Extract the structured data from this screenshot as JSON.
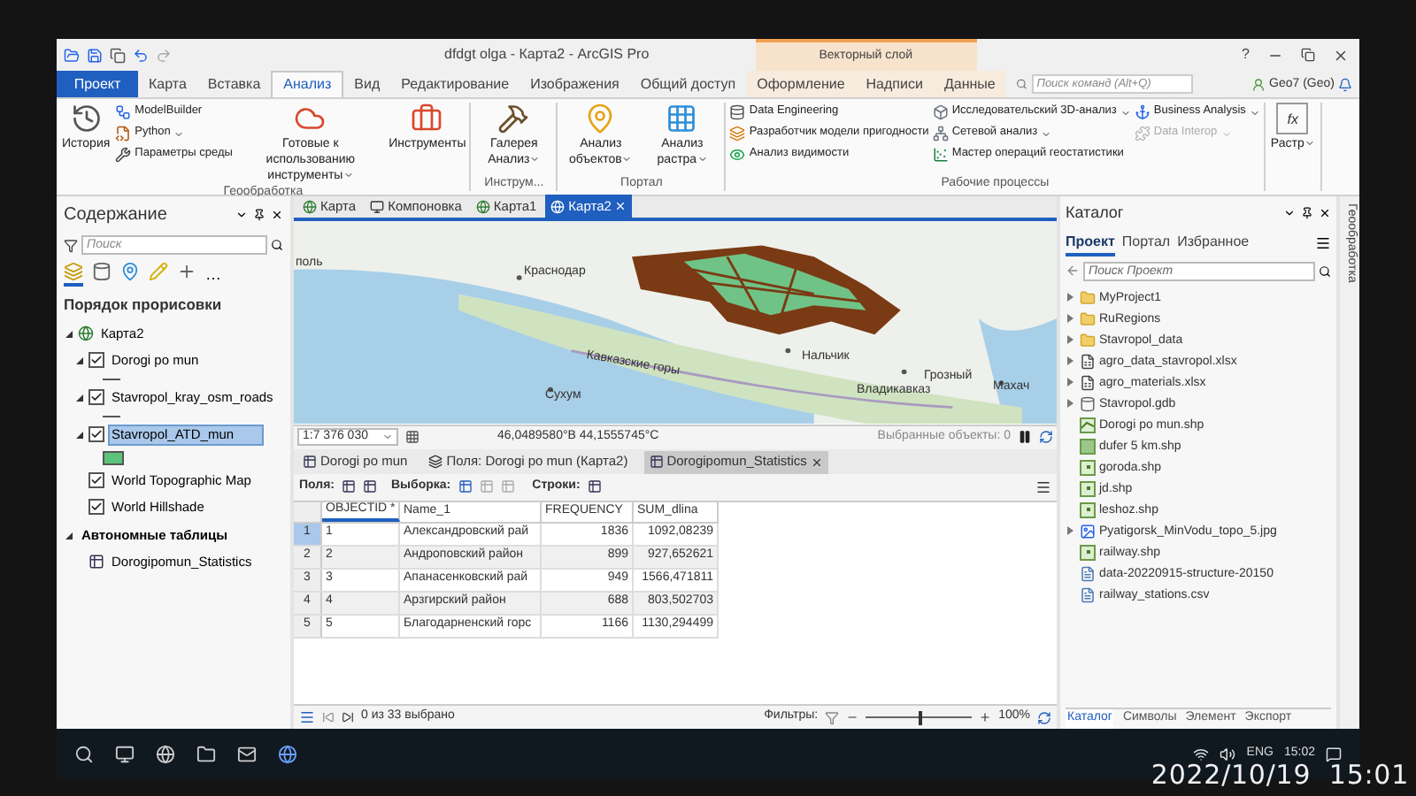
{
  "window": {
    "title": "dfdgt olga - Карта2 - ArcGIS Pro",
    "context_label": "Векторный слой",
    "help": "?"
  },
  "ribbon_tabs": [
    {
      "label": "Проект",
      "kind": "backstage",
      "selected": false
    },
    {
      "label": "Карта",
      "kind": "tab",
      "selected": false
    },
    {
      "label": "Вставка",
      "kind": "tab",
      "selected": false
    },
    {
      "label": "Анализ",
      "kind": "tab",
      "selected": true
    },
    {
      "label": "Вид",
      "kind": "tab",
      "selected": false
    },
    {
      "label": "Редактирование",
      "kind": "tab",
      "selected": false
    },
    {
      "label": "Изображения",
      "kind": "tab",
      "selected": false
    },
    {
      "label": "Общий доступ",
      "kind": "tab",
      "selected": false
    },
    {
      "label": "Оформление",
      "kind": "context",
      "selected": false
    },
    {
      "label": "Надписи",
      "kind": "context",
      "selected": false
    },
    {
      "label": "Данные",
      "kind": "context",
      "selected": false
    }
  ],
  "command_search": {
    "placeholder": "Поиск команд (Alt+Q)"
  },
  "user": {
    "name": "Geo7 (Geo)"
  },
  "ribbon_groups": [
    {
      "title": "Геообработка",
      "items": [
        {
          "label": "История",
          "kind": "large",
          "dropdown": false,
          "disabled": false
        },
        {
          "label": "ModelBuilder",
          "kind": "small",
          "dropdown": false,
          "disabled": false
        },
        {
          "label": "Python",
          "kind": "small",
          "dropdown": true,
          "disabled": false
        },
        {
          "label": "Параметры среды",
          "kind": "small",
          "dropdown": false,
          "disabled": false
        },
        {
          "label": "Готовые к использованию инструменты",
          "kind": "large",
          "dropdown": true,
          "disabled": false
        },
        {
          "label": "Инструменты",
          "kind": "large",
          "dropdown": false,
          "disabled": false
        }
      ]
    },
    {
      "title": "Инструм...",
      "items": [
        {
          "label": "Галерея Анализ",
          "kind": "large",
          "dropdown": true,
          "disabled": false
        }
      ]
    },
    {
      "title": "Портал",
      "items": [
        {
          "label": "Анализ объектов",
          "kind": "large",
          "dropdown": true,
          "disabled": false
        },
        {
          "label": "Анализ растра",
          "kind": "large",
          "dropdown": true,
          "disabled": false
        }
      ]
    },
    {
      "title": "Рабочие процессы",
      "items": [
        {
          "label": "Data Engineering",
          "kind": "small",
          "dropdown": false,
          "disabled": false
        },
        {
          "label": "Разработчик модели пригодности",
          "kind": "small",
          "dropdown": false,
          "disabled": false
        },
        {
          "label": "Анализ видимости",
          "kind": "small",
          "dropdown": false,
          "disabled": false
        },
        {
          "label": "Исследовательский 3D-анализ",
          "kind": "small",
          "dropdown": true,
          "disabled": false
        },
        {
          "label": "Сетевой анализ",
          "kind": "small",
          "dropdown": true,
          "disabled": false
        },
        {
          "label": "Мастер операций геостатистики",
          "kind": "small",
          "dropdown": false,
          "disabled": false
        },
        {
          "label": "Business Analysis",
          "kind": "small",
          "dropdown": true,
          "disabled": false
        },
        {
          "label": "Data Interop",
          "kind": "small",
          "dropdown": true,
          "disabled": true
        }
      ]
    },
    {
      "items": [
        {
          "label": "Растр",
          "kind": "large",
          "dropdown": true,
          "disabled": false,
          "glyph": "fx"
        }
      ]
    }
  ],
  "contents": {
    "title": "Содержание",
    "search": {
      "placeholder": "Поиск"
    },
    "modes": [
      {
        "selected": true
      },
      {
        "selected": false
      },
      {
        "selected": false
      },
      {
        "selected": false
      },
      {
        "selected": false
      }
    ],
    "more": "…",
    "heading": "Порядок прорисовки",
    "tree": [
      {
        "label": "Карта2",
        "kind": "map",
        "expanded": true,
        "children": [
          {
            "label": "Dorogi po mun",
            "kind": "layer",
            "checked": true,
            "expanded": true,
            "legend": {
              "kind": "line"
            },
            "selected": false
          },
          {
            "label": "Stavropol_kray_osm_roads",
            "kind": "layer",
            "checked": true,
            "expanded": true,
            "legend": {
              "kind": "line"
            },
            "selected": false
          },
          {
            "label": "Stavropol_ATD_mun",
            "kind": "layer",
            "checked": true,
            "expanded": true,
            "legend": {
              "kind": "polygon"
            },
            "selected": true
          },
          {
            "label": "World Topographic Map",
            "kind": "basemap",
            "checked": true,
            "selected": false
          },
          {
            "label": "World Hillshade",
            "kind": "basemap",
            "checked": true,
            "selected": false
          }
        ]
      },
      {
        "label": "Автономные таблицы",
        "kind": "group",
        "expanded": true,
        "children": [
          {
            "label": "Dorogipomun_Statistics",
            "kind": "table",
            "selected": false
          }
        ]
      }
    ]
  },
  "view_tabs": [
    {
      "label": "Карта",
      "kind": "map",
      "selected": false
    },
    {
      "label": "Компоновка",
      "kind": "layout",
      "selected": false
    },
    {
      "label": "Карта1",
      "kind": "map",
      "selected": false
    },
    {
      "label": "Карта2",
      "kind": "map",
      "selected": true
    }
  ],
  "map": {
    "labels": [
      "поль",
      "Краснодар",
      "Кавказские горы",
      "Сухум",
      "Нальчик",
      "Владикавказ",
      "Грозный",
      "Махач"
    ],
    "scale": "1:7 376 030",
    "coordinates": "46,0489580°В 44,1555745°С",
    "selected_features": "Выбранные объекты: 0"
  },
  "table_tabs": [
    {
      "label": "Dorogi po mun",
      "kind": "table",
      "selected": false
    },
    {
      "label": "Поля:  Dorogi po mun (Карта2)",
      "kind": "fields",
      "selected": false
    },
    {
      "label": "Dorogipomun_Statistics",
      "kind": "table",
      "selected": true
    }
  ],
  "table_toolbar": {
    "fields": "Поля:",
    "selection": "Выборка:",
    "rows": "Строки:"
  },
  "table": {
    "columns": [
      "OBJECTID *",
      "Name_1",
      "FREQUENCY",
      "SUM_dlina"
    ],
    "rows": [
      {
        "number": "1",
        "active": true,
        "cells": [
          "1",
          "Александровский рай",
          "1836",
          "1092,08239"
        ]
      },
      {
        "number": "2",
        "active": false,
        "cells": [
          "2",
          "Андроповский район",
          "899",
          "927,652621"
        ]
      },
      {
        "number": "3",
        "active": false,
        "cells": [
          "3",
          "Апанасенковский рай",
          "949",
          "1566,471811"
        ]
      },
      {
        "number": "4",
        "active": false,
        "cells": [
          "4",
          "Арзгирский район",
          "688",
          "803,502703"
        ]
      },
      {
        "number": "5",
        "active": false,
        "cells": [
          "5",
          "Благодарненский горс",
          "1166",
          "1130,294499"
        ]
      }
    ]
  },
  "table_footer": {
    "selection": "0 из 33 выбрано",
    "filters": "Фильтры:",
    "zoom": {
      "level": 0.5,
      "reading": "100%"
    }
  },
  "catalog": {
    "title": "Каталог",
    "tabs": [
      {
        "label": "Проект",
        "selected": true
      },
      {
        "label": "Портал",
        "selected": false
      },
      {
        "label": "Избранное",
        "selected": false
      }
    ],
    "search": {
      "placeholder": "Поиск Проект"
    },
    "items": [
      {
        "label": "MyProject1",
        "kind": "folder",
        "expandable": true
      },
      {
        "label": "RuRegions",
        "kind": "folder",
        "expandable": true
      },
      {
        "label": "Stavropol_data",
        "kind": "folder",
        "expandable": true
      },
      {
        "label": "agro_data_stavropol.xlsx",
        "kind": "workbook",
        "expandable": true
      },
      {
        "label": "agro_materials.xlsx",
        "kind": "workbook",
        "expandable": true
      },
      {
        "label": "Stavropol.gdb",
        "kind": "gdb",
        "expandable": true
      },
      {
        "label": "Dorogi po mun.shp",
        "kind": "line",
        "expandable": false
      },
      {
        "label": "dufer 5 km.shp",
        "kind": "polygon",
        "expandable": false
      },
      {
        "label": "goroda.shp",
        "kind": "point",
        "expandable": false
      },
      {
        "label": "jd.shp",
        "kind": "point",
        "expandable": false
      },
      {
        "label": "leshoz.shp",
        "kind": "point",
        "expandable": false
      },
      {
        "label": "Pyatigorsk_MinVodu_topo_5.jpg",
        "kind": "raster",
        "expandable": true
      },
      {
        "label": "railway.shp",
        "kind": "point",
        "expandable": false
      },
      {
        "label": "data-20220915-structure-20150",
        "kind": "file",
        "expandable": false
      },
      {
        "label": "railway_stations.csv",
        "kind": "file",
        "expandable": false
      }
    ],
    "bottom_tabs": [
      {
        "label": "Каталог",
        "selected": true
      },
      {
        "label": "Символы",
        "selected": false
      },
      {
        "label": "Элемент",
        "selected": false
      },
      {
        "label": "Экспорт",
        "selected": false
      }
    ]
  },
  "side_strip": "Геообработка",
  "taskbar": {
    "lang": "ENG",
    "time": "15:02"
  },
  "photo_stamp": "2022/10/19  15:01"
}
